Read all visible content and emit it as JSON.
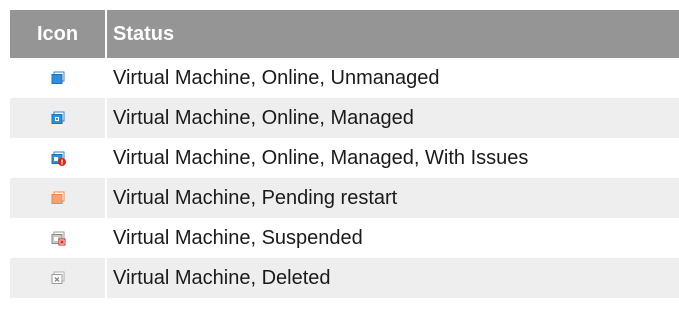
{
  "table": {
    "headers": {
      "icon": "Icon",
      "status": "Status"
    },
    "rows": [
      {
        "icon": "vm-online-unmanaged-icon",
        "status": "Virtual Machine, Online, Unmanaged",
        "color": "#2f8fdc"
      },
      {
        "icon": "vm-online-managed-icon",
        "status": "Virtual Machine, Online, Managed",
        "color": "#2f8fdc"
      },
      {
        "icon": "vm-online-managed-issues-icon",
        "status": "Virtual Machine, Online, Managed, With Issues",
        "color": "#2f8fdc"
      },
      {
        "icon": "vm-pending-restart-icon",
        "status": "Virtual Machine, Pending restart",
        "color": "#f4a46a"
      },
      {
        "icon": "vm-suspended-icon",
        "status": "Virtual Machine, Suspended",
        "color": "#c8c8c8"
      },
      {
        "icon": "vm-deleted-icon",
        "status": "Virtual Machine, Deleted",
        "color": "#9a9a9a"
      }
    ]
  },
  "colors": {
    "header_bg": "#959595",
    "header_text": "#ffffff",
    "alt_row_bg": "#eeeeee",
    "issue_badge": "#d9241b"
  }
}
